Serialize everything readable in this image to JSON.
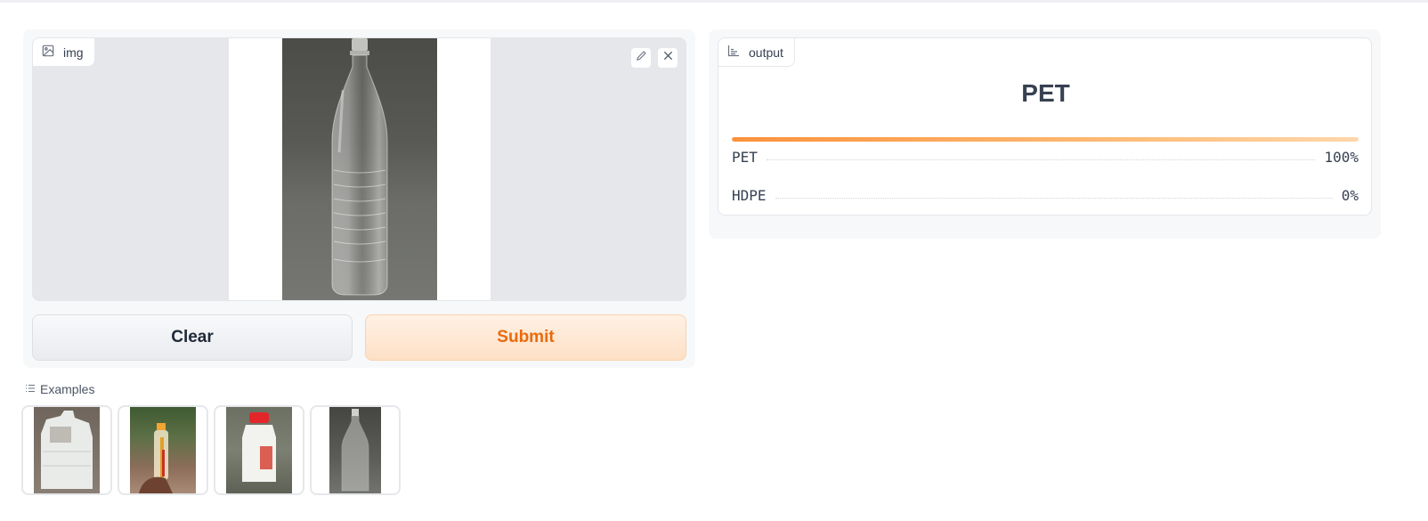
{
  "input": {
    "label": "img",
    "icon": "image-icon",
    "tools": [
      "edit-icon",
      "close-icon"
    ]
  },
  "buttons": {
    "clear_label": "Clear",
    "submit_label": "Submit"
  },
  "output": {
    "label": "output",
    "icon": "bar-chart-icon",
    "top_class": "PET",
    "top_confidence": 1.0,
    "confidences": [
      {
        "label": "PET",
        "value": "100%"
      },
      {
        "label": "HDPE",
        "value": "0%"
      }
    ]
  },
  "examples": {
    "label": "Examples",
    "items": [
      "jerrycan",
      "bottle-held-in-hand",
      "milk-jug-red-cap",
      "clear-plastic-bottle"
    ]
  },
  "colors": {
    "accent": "#ea6a0c",
    "bar_start": "#fb923c",
    "bar_end": "#fed7aa"
  }
}
